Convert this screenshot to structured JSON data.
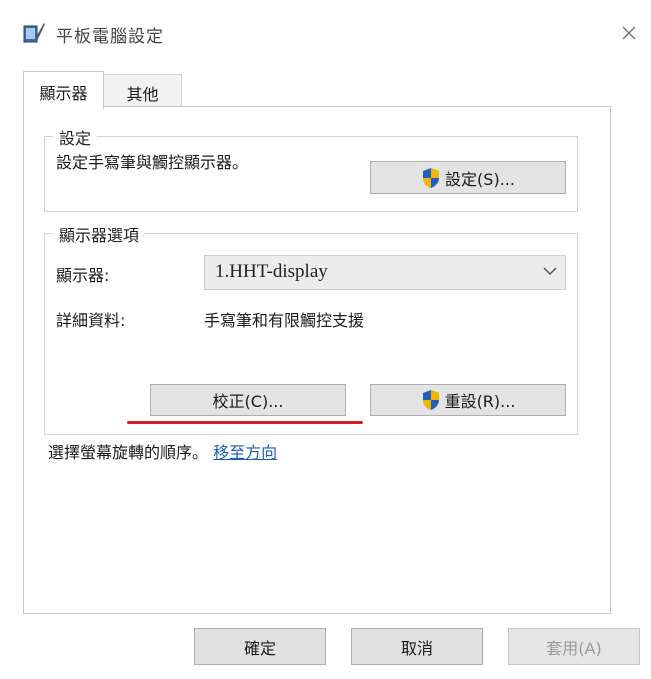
{
  "window": {
    "title": "平板電腦設定",
    "app_icon": "tablet-settings-icon",
    "close_icon": "close-icon"
  },
  "tabs": [
    {
      "label": "顯示器",
      "selected": true
    },
    {
      "label": "其他",
      "selected": false
    }
  ],
  "setup_group": {
    "title": "設定",
    "description": "設定手寫筆與觸控顯示器。",
    "setup_button_label": "設定(S)...",
    "setup_button_icon": "uac-shield-icon"
  },
  "display_options_group": {
    "title": "顯示器選項",
    "display_label": "顯示器:",
    "display_selected": "1.HHT-display",
    "details_label": "詳細資料:",
    "details_value": "手寫筆和有限觸控支援",
    "calibrate_button_label": "校正(C)...",
    "reset_button_label": "重設(R)...",
    "reset_button_icon": "uac-shield-icon"
  },
  "rotation": {
    "text": "選擇螢幕旋轉的順序。",
    "link_label": "移至方向"
  },
  "footer": {
    "ok_label": "確定",
    "cancel_label": "取消",
    "apply_label": "套用(A)"
  },
  "colors": {
    "link": "#1a5fb4",
    "annotation_underline": "#d32020",
    "shield_blue": "#1f5fbf",
    "shield_gold": "#f2b600"
  }
}
